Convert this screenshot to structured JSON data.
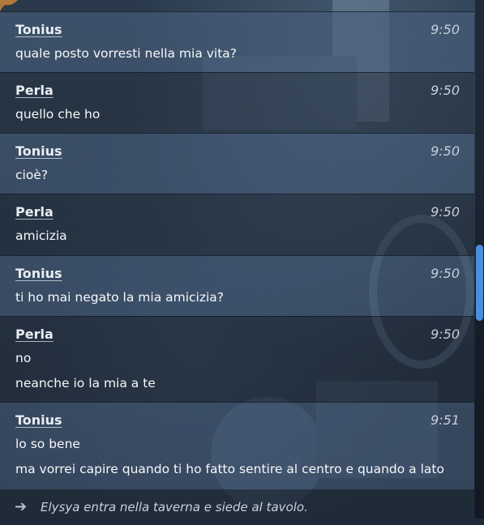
{
  "messages": [
    {
      "author": "Tonius",
      "time": "9:50",
      "lines": [
        "quale posto vorresti nella mia vita?"
      ],
      "style": "a"
    },
    {
      "author": "Perla",
      "time": "9:50",
      "lines": [
        "quello che ho"
      ],
      "style": "b"
    },
    {
      "author": "Tonius",
      "time": "9:50",
      "lines": [
        "cioè?"
      ],
      "style": "a"
    },
    {
      "author": "Perla",
      "time": "9:50",
      "lines": [
        "amicizia"
      ],
      "style": "b"
    },
    {
      "author": "Tonius",
      "time": "9:50",
      "lines": [
        "ti ho mai negato la mia amicizia?"
      ],
      "style": "a"
    },
    {
      "author": "Perla",
      "time": "9:50",
      "lines": [
        "no",
        "neanche io la mia a te"
      ],
      "style": "b"
    },
    {
      "author": "Tonius",
      "time": "9:51",
      "lines": [
        "lo so bene",
        "ma vorrei capire quando ti ho fatto sentire al centro e quando a lato"
      ],
      "style": "a"
    }
  ],
  "system_message": {
    "icon": "arrow-right-icon",
    "text": "Elysya entra nella taverna e siede al tavolo."
  },
  "colors": {
    "accent": "#4a8fdc"
  }
}
